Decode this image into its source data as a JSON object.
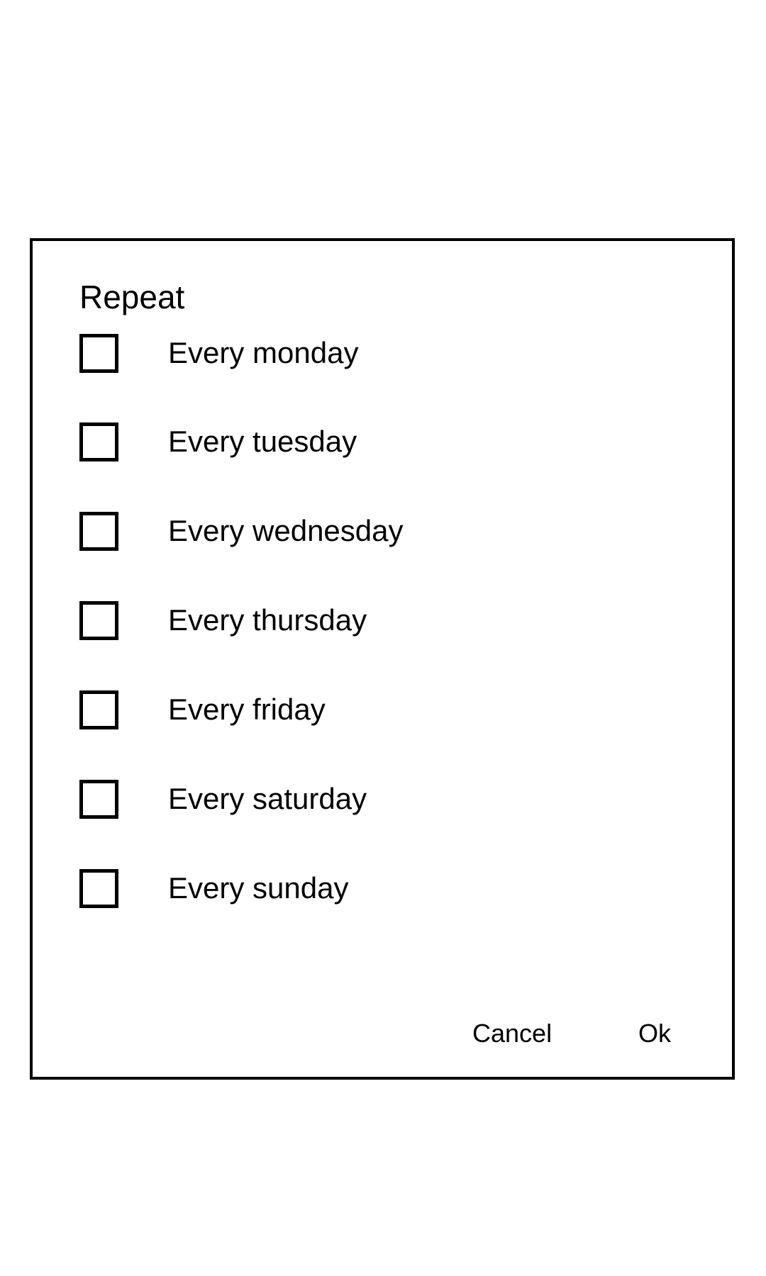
{
  "dialog": {
    "title": "Repeat",
    "options": [
      {
        "label": "Every monday",
        "checked": false
      },
      {
        "label": "Every tuesday",
        "checked": false
      },
      {
        "label": "Every wednesday",
        "checked": false
      },
      {
        "label": "Every thursday",
        "checked": false
      },
      {
        "label": "Every friday",
        "checked": false
      },
      {
        "label": "Every saturday",
        "checked": false
      },
      {
        "label": "Every sunday",
        "checked": false
      }
    ],
    "cancel_label": "Cancel",
    "ok_label": "Ok"
  }
}
